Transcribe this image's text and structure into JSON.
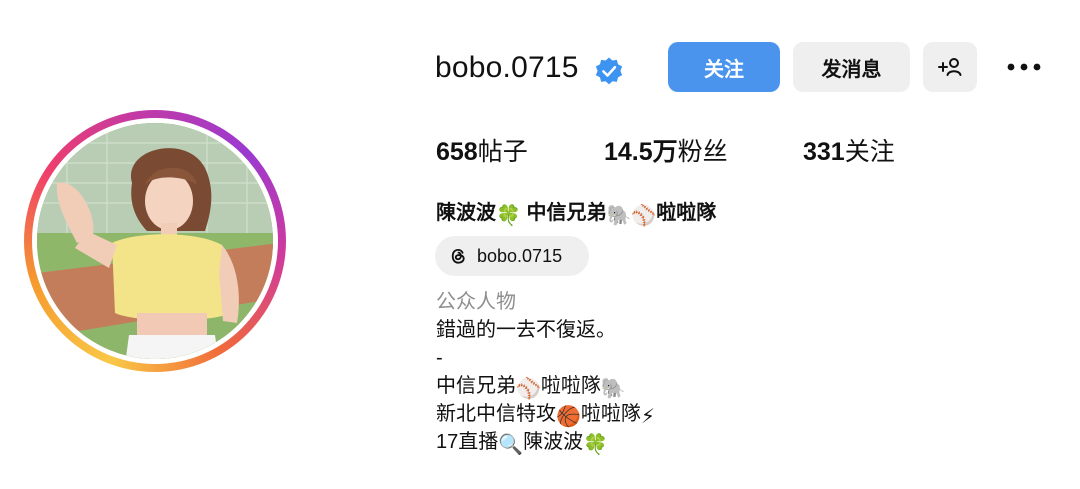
{
  "profile": {
    "username": "bobo.0715",
    "verified": true,
    "follow_label": "关注",
    "message_label": "发消息",
    "add_user_label": "+",
    "stats": {
      "posts": "658",
      "posts_label": "帖子",
      "followers": "14.5万",
      "followers_label": "粉丝",
      "following": "331",
      "following_label": "关注"
    },
    "full_name": {
      "part1": "陳波波",
      "part2": " 中信兄弟",
      "part3": "啦啦隊"
    },
    "threads_handle": "bobo.0715",
    "category": "公众人物",
    "bio": {
      "line1": "錯過的一去不復返。",
      "line2": "-",
      "line3a": "中信兄弟",
      "line3b": "啦啦隊",
      "line4a": "新北中信特攻",
      "line4b": "啦啦隊",
      "line5a": "17直播",
      "line5b": "陳波波"
    }
  },
  "icons": {
    "verified": "verified-badge-icon",
    "add_user": "add-user-icon",
    "more": "more-options-icon",
    "threads": "threads-icon"
  },
  "colors": {
    "follow_button": "#4a94ee",
    "secondary_button": "#efefef",
    "verified_badge": "#3d93f0",
    "category_text": "#8e8e8e"
  }
}
